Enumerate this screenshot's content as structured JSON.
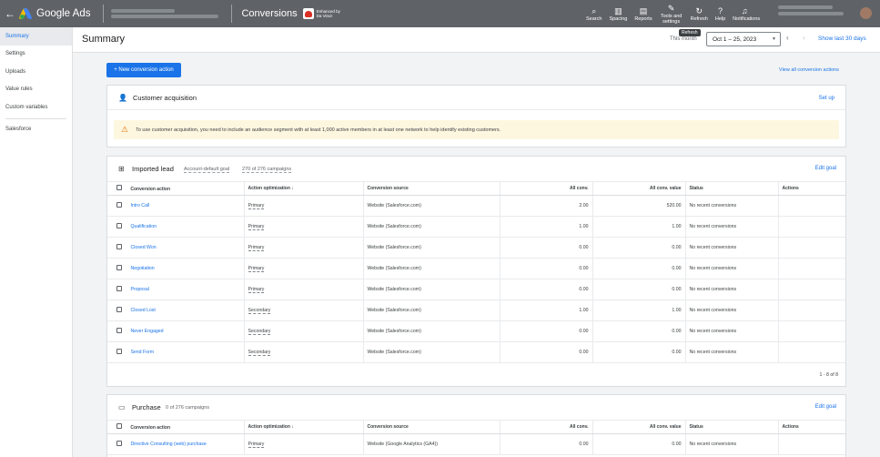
{
  "topbar": {
    "brand": "Google Ads",
    "page": "Conversions",
    "enhanced": "Enhanced by Da Vinci!",
    "tools": [
      {
        "icon": "search-icon",
        "glyph": "⌕",
        "label": "Search"
      },
      {
        "icon": "spacing-icon",
        "glyph": "▥",
        "label": "Spacing"
      },
      {
        "icon": "reports-icon",
        "glyph": "▤",
        "label": "Reports"
      },
      {
        "icon": "wrench-icon",
        "glyph": "✎",
        "label": "Tools and settings"
      },
      {
        "icon": "refresh-icon",
        "glyph": "↻",
        "label": "Refresh"
      },
      {
        "icon": "help-icon",
        "glyph": "?",
        "label": "Help"
      },
      {
        "icon": "bell-icon",
        "glyph": "♫",
        "label": "Notifications"
      }
    ]
  },
  "sidebar": {
    "items": [
      "Summary",
      "Settings",
      "Uploads",
      "Value rules",
      "Custom variables",
      "Salesforce"
    ]
  },
  "header": {
    "title": "Summary",
    "date_label": "This month",
    "tooltip": "Refresh",
    "date_range": "Oct 1 – 25, 2023",
    "show_last": "Show last 30 days"
  },
  "actions": {
    "new_conversion": "+ New conversion action",
    "view_all": "View all conversion actions"
  },
  "customer_acquisition": {
    "title": "Customer acquisition",
    "setup": "Set up",
    "warning": "To use customer acquisition, you need to include an audience segment with at least 1,000 active members in at least one network to help identify existing customers."
  },
  "imported_lead": {
    "title": "Imported lead",
    "goal": "Account-default goal",
    "campaigns": "270 of 276 campaigns",
    "edit": "Edit goal",
    "columns": [
      "Conversion action",
      "Action optimization ↓",
      "Conversion source",
      "All conv.",
      "All conv. value",
      "Status",
      "Actions"
    ],
    "rows": [
      {
        "name": "Intro Call",
        "opt": "Primary",
        "source": "Website (Salesforce.com)",
        "conv": "2.00",
        "value": "520.00",
        "status": "No recent conversions"
      },
      {
        "name": "Qualification",
        "opt": "Primary",
        "source": "Website (Salesforce.com)",
        "conv": "1.00",
        "value": "1.00",
        "status": "No recent conversions"
      },
      {
        "name": "Closed Won",
        "opt": "Primary",
        "source": "Website (Salesforce.com)",
        "conv": "0.00",
        "value": "0.00",
        "status": "No recent conversions"
      },
      {
        "name": "Negotiation",
        "opt": "Primary",
        "source": "Website (Salesforce.com)",
        "conv": "0.00",
        "value": "0.00",
        "status": "No recent conversions"
      },
      {
        "name": "Proposal",
        "opt": "Primary",
        "source": "Website (Salesforce.com)",
        "conv": "0.00",
        "value": "0.00",
        "status": "No recent conversions"
      },
      {
        "name": "Closed Lost",
        "opt": "Secondary",
        "source": "Website (Salesforce.com)",
        "conv": "1.00",
        "value": "1.00",
        "status": "No recent conversions"
      },
      {
        "name": "Never Engaged",
        "opt": "Secondary",
        "source": "Website (Salesforce.com)",
        "conv": "0.00",
        "value": "0.00",
        "status": "No recent conversions"
      },
      {
        "name": "Send Form",
        "opt": "Secondary",
        "source": "Website (Salesforce.com)",
        "conv": "0.00",
        "value": "0.00",
        "status": "No recent conversions"
      }
    ],
    "pager": "1 - 8 of 8"
  },
  "purchase": {
    "title": "Purchase",
    "campaigns": "0 of 276 campaigns",
    "edit": "Edit goal",
    "columns": [
      "Conversion action",
      "Action optimization ↓",
      "Conversion source",
      "All conv.",
      "All conv. value",
      "Status",
      "Actions"
    ],
    "rows": [
      {
        "name": "Directive Consulting (web) purchase",
        "opt": "Primary",
        "source": "Website (Google Analytics (GA4))",
        "conv": "0.00",
        "value": "0.00",
        "status": "No recent conversions"
      }
    ]
  }
}
